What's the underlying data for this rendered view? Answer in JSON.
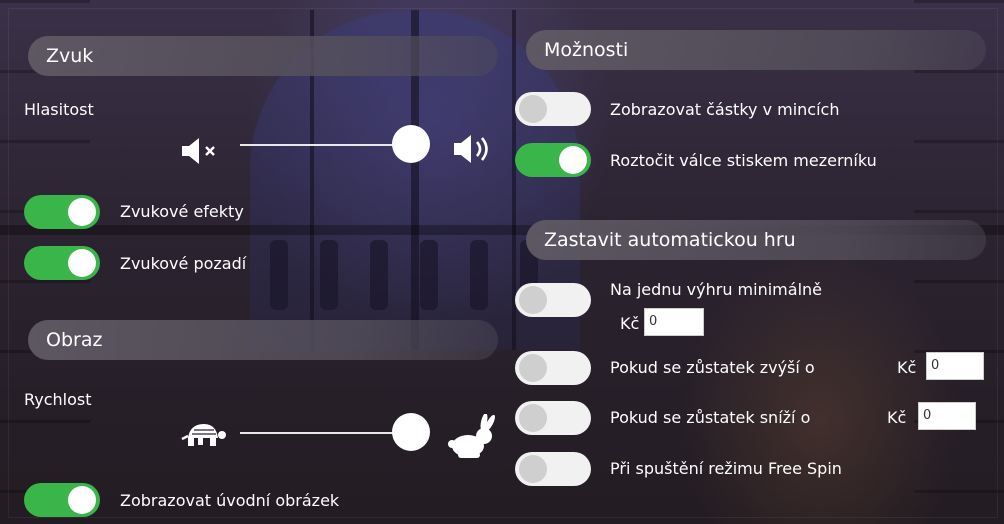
{
  "sections": {
    "sound": {
      "title": "Zvuk",
      "volume_label": "Hlasitost",
      "volume_level_percent": 100,
      "toggles": [
        {
          "label": "Zvukové efekty",
          "on": true
        },
        {
          "label": "Zvukové pozadí",
          "on": true
        }
      ]
    },
    "image": {
      "title": "Obraz",
      "speed_label": "Rychlost",
      "speed_level_percent": 100,
      "intro_toggle": {
        "label": "Zobrazovat úvodní obrázek",
        "on": true
      }
    },
    "options": {
      "title": "Možnosti",
      "toggles": [
        {
          "label": "Zobrazovat částky v mincích",
          "on": false
        },
        {
          "label": "Roztočit válce stiskem mezerníku",
          "on": true
        }
      ]
    },
    "autoplay": {
      "title": "Zastavit automatickou hru",
      "currency": "Kč",
      "items": [
        {
          "label": "Na jednu výhru minimálně",
          "value": "0",
          "on": false
        },
        {
          "label": "Pokud se zůstatek zvýší o",
          "value": "0",
          "on": false
        },
        {
          "label": "Pokud se zůstatek sníží o",
          "value": "0",
          "on": false
        },
        {
          "label": "Při spuštění režimu Free Spin",
          "on": false
        }
      ]
    }
  },
  "icons": {
    "mute": "speaker-mute-icon",
    "volume": "speaker-volume-icon",
    "slow": "turtle-icon",
    "fast": "rabbit-icon"
  },
  "colors": {
    "toggle_on": "#39b54a",
    "toggle_off": "#f1f1f1",
    "text": "#ffffff"
  }
}
